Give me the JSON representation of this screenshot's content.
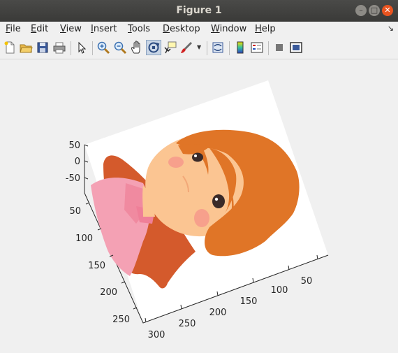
{
  "window": {
    "title": "Figure 1"
  },
  "menu": {
    "items": [
      {
        "u": "F",
        "rest": "ile"
      },
      {
        "u": "E",
        "rest": "dit"
      },
      {
        "u": "V",
        "rest": "iew"
      },
      {
        "u": "I",
        "rest": "nsert"
      },
      {
        "u": "T",
        "rest": "ools"
      },
      {
        "u": "D",
        "rest": "esktop"
      },
      {
        "u": "W",
        "rest": "indow"
      },
      {
        "u": "H",
        "rest": "elp"
      }
    ],
    "arrow": "↘"
  },
  "toolbar": {
    "icons": [
      "new-figure-icon",
      "open-file-icon",
      "save-icon",
      "print-icon",
      "pointer-icon",
      "zoom-in-icon",
      "zoom-out-icon",
      "pan-icon",
      "rotate-3d-icon",
      "data-cursor-icon",
      "brush-icon",
      "link-plot-icon",
      "colorbar-icon",
      "legend-icon",
      "hide-plot-tools-icon",
      "show-plot-tools-icon"
    ],
    "pressed": "rotate-3d-icon"
  },
  "axes": {
    "z_ticks": [
      "50",
      "0",
      "-50"
    ],
    "y_ticks": [
      "50",
      "100",
      "150",
      "200",
      "250"
    ],
    "x_ticks": [
      "300",
      "250",
      "200",
      "150",
      "100",
      "50"
    ]
  },
  "colors": {
    "hair": "#e07527",
    "hair_dark": "#d45a2c",
    "skin": "#fbc592",
    "shirt": "#f4a1b4",
    "cheek": "#f7a08c",
    "eye": "#3a2a28"
  }
}
